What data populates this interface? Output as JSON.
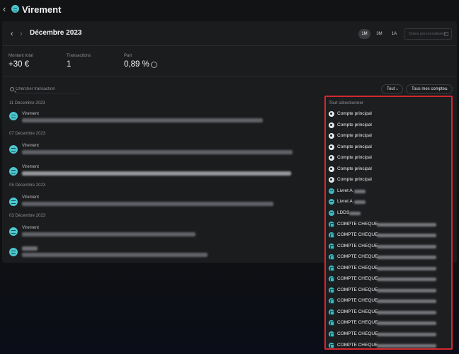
{
  "header": {
    "title": "Virement",
    "back_icon": "chevron-left-icon",
    "app_icon": "transfer-icon"
  },
  "period": {
    "label": "Décembre 2023",
    "ranges": [
      "1M",
      "3M",
      "1A"
    ],
    "active_range": "1M",
    "custom_dates": "Dates personnalisées"
  },
  "stats": {
    "total_label": "Montant total",
    "total_value": "+30 €",
    "count_label": "Transactions",
    "count_value": "1",
    "share_label": "Part",
    "share_value": "0,89 %"
  },
  "search": {
    "placeholder": "Chercher transaction"
  },
  "filters": {
    "type": "Tout",
    "accounts": "Tous mes comptes"
  },
  "transactions": [
    {
      "date": "11 Décembre 2023",
      "title": "Virement"
    },
    {
      "date": "07 Décembre 2023",
      "title": "Virement"
    },
    {
      "title": "Virement"
    },
    {
      "date": "05 Décembre 2023",
      "title": "Virement"
    },
    {
      "date": "03 Décembre 2023",
      "title": "Virement"
    },
    {
      "title": ""
    }
  ],
  "accounts_dropdown": {
    "select_all": "Tout sélectionner",
    "items": [
      {
        "label": "Compte principal",
        "kind": "main"
      },
      {
        "label": "Compte principal",
        "kind": "main"
      },
      {
        "label": "Compte principal",
        "kind": "main"
      },
      {
        "label": "Compte principal",
        "kind": "main"
      },
      {
        "label": "Compte principal",
        "kind": "main"
      },
      {
        "label": "Compte principal",
        "kind": "main"
      },
      {
        "label": "Compte principal",
        "kind": "main"
      },
      {
        "label": "Livret A",
        "kind": "save"
      },
      {
        "label": "Livret A",
        "kind": "save"
      },
      {
        "label": "LDDS",
        "kind": "save"
      },
      {
        "label": "COMPTE CHEQUE",
        "kind": "bank"
      },
      {
        "label": "COMPTE CHEQUE",
        "kind": "bank"
      },
      {
        "label": "COMPTE CHEQUE",
        "kind": "bank"
      },
      {
        "label": "COMPTE CHEQUE",
        "kind": "bank"
      },
      {
        "label": "COMPTE CHEQUE",
        "kind": "bank"
      },
      {
        "label": "COMPTE CHEQUE",
        "kind": "bank"
      },
      {
        "label": "COMPTE CHEQUE",
        "kind": "bank"
      },
      {
        "label": "COMPTE CHEQUE",
        "kind": "bank"
      },
      {
        "label": "COMPTE CHEQUE",
        "kind": "bank"
      },
      {
        "label": "COMPTE CHEQUE",
        "kind": "bank"
      },
      {
        "label": "COMPTE CHEQUE",
        "kind": "bank"
      },
      {
        "label": "COMPTE CHEQUE",
        "kind": "bank"
      }
    ]
  },
  "colors": {
    "accent": "#4dc6cf",
    "highlight_border": "#d2272f",
    "panel": "#1b1c1e"
  }
}
